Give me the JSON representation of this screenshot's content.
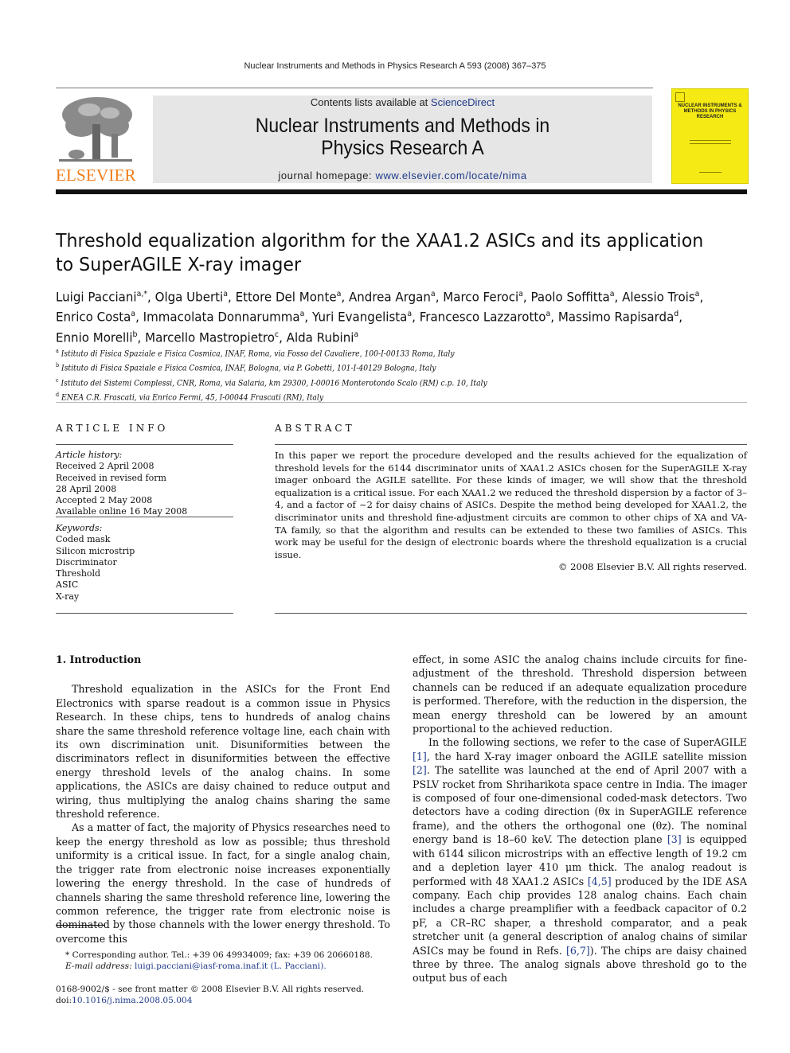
{
  "running_head": "Nuclear Instruments and Methods in Physics Research A 593 (2008) 367–375",
  "masthead": {
    "contents_prefix": "Contents lists available at ",
    "contents_link": "ScienceDirect",
    "journal_title_line1": "Nuclear Instruments and Methods in",
    "journal_title_line2": "Physics Research A",
    "homepage_prefix": "journal homepage: ",
    "homepage_link": "www.elsevier.com/locate/nima",
    "publisher_logo_text": "ELSEVIER",
    "publisher_color": "#f07d1a",
    "cover_title": "NUCLEAR INSTRUMENTS & METHODS IN PHYSICS RESEARCH",
    "cover_color": "#f5ea13"
  },
  "article": {
    "title": "Threshold equalization algorithm for the XAA1.2 ASICs and its application to SuperAGILE X-ray imager",
    "authors": [
      {
        "name": "Luigi Pacciani",
        "aff": "a,*"
      },
      {
        "name": "Olga Uberti",
        "aff": "a"
      },
      {
        "name": "Ettore Del Monte",
        "aff": "a"
      },
      {
        "name": "Andrea Argan",
        "aff": "a"
      },
      {
        "name": "Marco Feroci",
        "aff": "a"
      },
      {
        "name": "Paolo Soffitta",
        "aff": "a"
      },
      {
        "name": "Alessio Trois",
        "aff": "a"
      },
      {
        "name": "Enrico Costa",
        "aff": "a"
      },
      {
        "name": "Immacolata Donnarumma",
        "aff": "a"
      },
      {
        "name": "Yuri Evangelista",
        "aff": "a"
      },
      {
        "name": "Francesco Lazzarotto",
        "aff": "a"
      },
      {
        "name": "Massimo Rapisarda",
        "aff": "d"
      },
      {
        "name": "Ennio Morelli",
        "aff": "b"
      },
      {
        "name": "Marcello Mastropietro",
        "aff": "c"
      },
      {
        "name": "Alda Rubini",
        "aff": "a"
      }
    ],
    "affiliations": [
      {
        "key": "a",
        "text": "Istituto di Fisica Spaziale e Fisica Cosmica, INAF, Roma, via Fosso del Cavaliere, 100-I-00133 Roma, Italy"
      },
      {
        "key": "b",
        "text": "Istituto di Fisica Spaziale e Fisica Cosmica, INAF, Bologna, via P. Gobetti, 101-I-40129 Bologna, Italy"
      },
      {
        "key": "c",
        "text": "Istituto dei Sistemi Complessi, CNR, Roma, via Salaria, km 29300, I-00016 Monterotondo Scalo (RM) c.p. 10, Italy"
      },
      {
        "key": "d",
        "text": "ENEA C.R. Frascati, via Enrico Fermi, 45, I-00044 Frascati (RM), Italy"
      }
    ]
  },
  "article_info": {
    "label": "ARTICLE INFO",
    "history_label": "Article history:",
    "history": [
      "Received 2 April 2008",
      "Received in revised form",
      "28 April 2008",
      "Accepted 2 May 2008",
      "Available online 16 May 2008"
    ],
    "keywords_label": "Keywords:",
    "keywords": [
      "Coded mask",
      "Silicon microstrip",
      "Discriminator",
      "Threshold",
      "ASIC",
      "X-ray"
    ]
  },
  "abstract": {
    "label": "ABSTRACT",
    "text": "In this paper we report the procedure developed and the results achieved for the equalization of threshold levels for the 6144 discriminator units of XAA1.2 ASICs chosen for the SuperAGILE X-ray imager onboard the AGILE satellite. For these kinds of imager, we will show that the threshold equalization is a critical issue. For each XAA1.2 we reduced the threshold dispersion by a factor of 3–4, and a factor of ~2 for daisy chains of ASICs. Despite the method being developed for XAA1.2, the discriminator units and threshold fine-adjustment circuits are common to other chips of XA and VA-TA family, so that the algorithm and results can be extended to these two families of ASICs. This work may be useful for the design of electronic boards where the threshold equalization is a crucial issue.",
    "copyright": "© 2008 Elsevier B.V. All rights reserved."
  },
  "body": {
    "section_heading": "1.  Introduction",
    "left_paragraphs": [
      "Threshold equalization in the ASICs for the Front End Electronics with sparse readout is a common issue in Physics Research. In these chips, tens to hundreds of analog chains share the same threshold reference voltage line, each chain with its own discrimination unit. Disuniformities between the discriminators reflect in disuniformities between the effective energy threshold levels of the analog chains. In some applications, the ASICs are daisy chained to reduce output and wiring, thus multiplying the analog chains sharing the same threshold reference.",
      "As a matter of fact, the majority of Physics researches need to keep the energy threshold as low as possible; thus threshold uniformity is a critical issue. In fact, for a single analog chain, the trigger rate from electronic noise increases exponentially lowering the energy threshold. In the case of hundreds of channels sharing the same threshold reference line, lowering the common reference, the trigger rate from electronic noise is dominated by those channels with the lower energy threshold. To overcome this"
    ],
    "right_p1": "effect, in some ASIC the analog chains include circuits for fine-adjustment of the threshold. Threshold dispersion between channels can be reduced if an adequate equalization procedure is performed. Therefore, with the reduction in the dispersion, the mean energy threshold can be lowered by an amount proportional to the achieved reduction.",
    "right_p2": {
      "t1": "In the following sections, we refer to the case of SuperAGILE ",
      "ref1": "[1]",
      "t2": ", the hard X-ray imager onboard the AGILE satellite mission ",
      "ref2": "[2]",
      "t3": ". The satellite was launched at the end of April 2007 with a PSLV rocket from Shriharikota space centre in India. The imager is composed of four one-dimensional coded-mask detectors. Two detectors have a coding direction (θx in SuperAGILE reference frame), and the others the orthogonal one (θz). The nominal energy band is 18–60 keV. The detection plane ",
      "ref3": "[3]",
      "t4": " is equipped with 6144 silicon microstrips with an effective length of 19.2 cm and a depletion layer 410 μm thick. The analog readout is performed with 48 XAA1.2 ASICs ",
      "ref4": "[4,5]",
      "t5": " produced by the IDE ASA company. Each chip provides 128 analog chains. Each chain includes a charge preamplifier with a feedback capacitor of 0.2 pF, a CR–RC shaper, a threshold comparator, and a peak stretcher unit (a general description of analog chains of similar ASICs may be found in Refs. ",
      "ref5": "[6,7]",
      "t6": "). The chips are daisy chained three by three. The analog signals above threshold go to the output bus of each"
    }
  },
  "footnote": {
    "corresponding": "* Corresponding author. Tel.: +39 06 49934009; fax: +39 06 20660188.",
    "email_label": "E-mail address: ",
    "email": "luigi.pacciani@iasf-roma.inaf.it (L. Pacciani)."
  },
  "front_matter": {
    "line1": "0168-9002/$ - see front matter © 2008 Elsevier B.V. All rights reserved.",
    "doi_prefix": "doi:",
    "doi": "10.1016/j.nima.2008.05.004"
  }
}
